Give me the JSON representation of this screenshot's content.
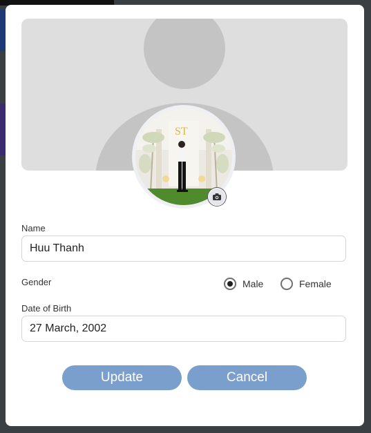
{
  "profile_form": {
    "name_label": "Name",
    "name_value": "Huu Thanh",
    "gender_label": "Gender",
    "gender_options": [
      {
        "label": "Male",
        "selected": true
      },
      {
        "label": "Female",
        "selected": false
      }
    ],
    "dob_label": "Date of Birth",
    "dob_value": "27 March, 2002",
    "update_label": "Update",
    "cancel_label": "Cancel"
  },
  "avatar_photo": {
    "sign_text": "ST"
  },
  "icons": {
    "camera": "camera-icon",
    "cover_placeholder": "user-silhouette-icon"
  },
  "colors": {
    "button": "#7b9fcd",
    "cover_bg": "#dedede",
    "silhouette": "#c4c4c4"
  }
}
